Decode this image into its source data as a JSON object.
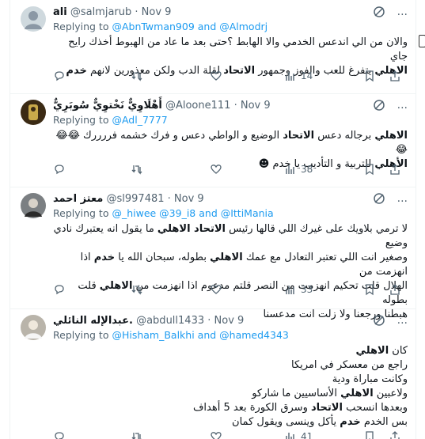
{
  "tweets": [
    {
      "name": "ali",
      "handle": "@salmjarub",
      "time": "Nov 9",
      "replying_prefix": "Replying to ",
      "replying_to": "@AbnTwman909 and @Almodrj",
      "lines": [
        "والان من الي اندعس الخدمي والا الهابط ؟حتى بعد ما عاد من الهبوط أخذك رايح جاي",
        "<b>الاهلي</b> يتفرغ للعب والفوز وجمهور <b>الاتحاد</b> لقلة الدب ولكن معذورين لانهم <b>خدم</b>"
      ],
      "views": "14",
      "avatar_color": "#cfd9de"
    },
    {
      "name": "أَهْلَاوِيٌّ نَخْتوِيٌّ سُوبَرِيٌّ",
      "handle": "@Aloone111",
      "time": "Nov 9",
      "replying_prefix": "Replying to ",
      "replying_to": "@Adl_7777",
      "lines": [
        "<b>الاهلي</b> برجاله دعس <b>الاتحاد</b> الوضيع و الواطي دعس و فرك خشمه فررررك 😂😂😂",
        "<b>الأهلي</b> للتربية و التأديب يا خدم ☻"
      ],
      "views": "38",
      "avatar_color": "#3b2a14"
    },
    {
      "name": "معتز احمد",
      "handle": "@sl997481",
      "time": "Nov 9",
      "replying_prefix": "Replying to ",
      "replying_to": "@_hiwee @39_i8 and @IttiMania",
      "lines": [
        "لا ترمي بلاويك على غيرك اللي قالها رئيس <b>الاتحاد الاهلي</b> ما يقول انه يعتبرك نادي وضيع",
        "وصغير انت اللي تعتبر التعادل مع عمك <b>الاهلي</b> بطوله، سبحان الله يا <b>خدم</b> اذا انهزمت من",
        "الهلال قلت تحكيم انهزمت من النصر قلتم مدعوم اذا انهزمت من <b>الاهلي</b> قلت بطوله",
        "هبطنا ورجعنا ولا زلت انت مدعسنا"
      ],
      "views": "33",
      "avatar_color": "#7b7f82"
    },
    {
      "name": "عبدالإله النائلي.",
      "handle": "@abdull1433",
      "time": "Nov 9",
      "replying_prefix": "Replying to ",
      "replying_to": "@Hisham_Balkhi and @hamed4343",
      "lines": [
        "كان <b>الاهلي</b>",
        "راجع من معسكر في امريكا",
        "وكانت مباراة ودية",
        "ولاعبين <b>الاهلي</b> الأساسيين ما شاركو",
        "وبعدها انسحب <b>الاتحاد</b> وسرق الكورة بعد 5 أهداف",
        "بس الخدم <b>خدم</b> يأكل وينسى ويقول كمان"
      ],
      "views": "41",
      "avatar_color": "#b9b4aa"
    }
  ]
}
